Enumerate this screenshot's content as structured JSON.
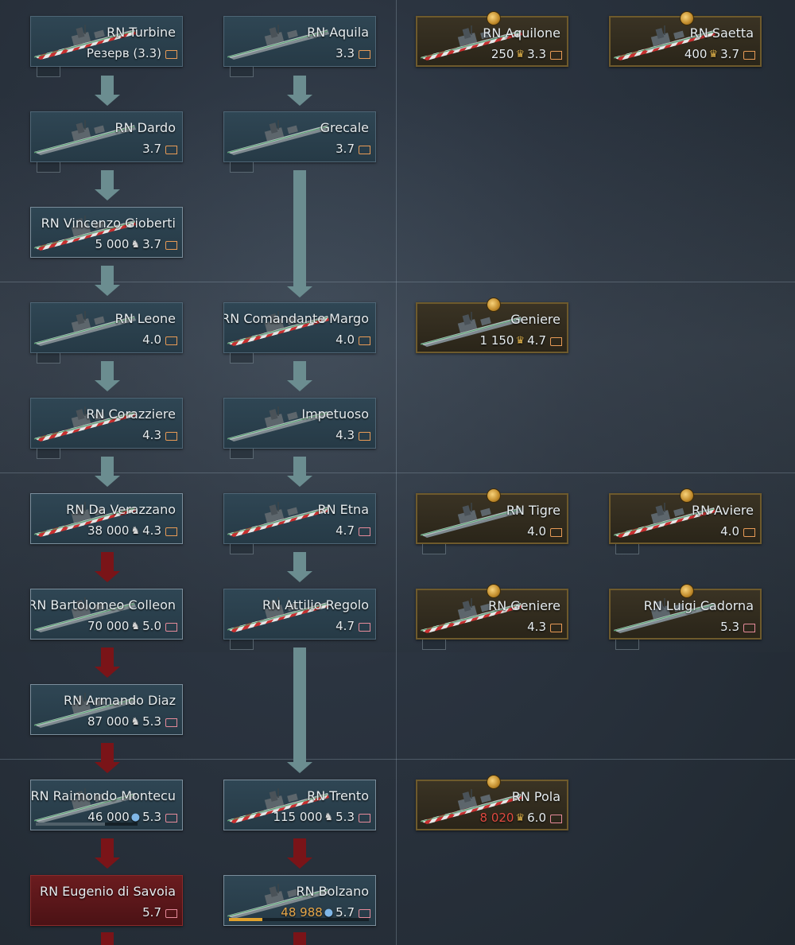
{
  "colors": {
    "premium_border": "#6e5a2c",
    "locked_bg": "#6b1c1f",
    "arrow_researched": "#6b8d90",
    "arrow_locked": "#7a1418",
    "progress": "#e0a22e"
  },
  "cards": {
    "turbine": {
      "name": "RN Turbine",
      "status": "Резерв (3.3)"
    },
    "aquila": {
      "name": "RN Aquila",
      "br": "3.3"
    },
    "aquilone": {
      "name": "RN Aquilone",
      "cost": "250",
      "br": "3.3"
    },
    "saetta": {
      "name": "RN Saetta",
      "cost": "400",
      "br": "3.7"
    },
    "dardo": {
      "name": "RN Dardo",
      "br": "3.7"
    },
    "grecale": {
      "name": "Grecale",
      "br": "3.7"
    },
    "gioberti": {
      "name": "RN Vincenzo Gioberti",
      "cost": "5 000",
      "br": "3.7"
    },
    "leone": {
      "name": "RN Leone",
      "br": "4.0"
    },
    "margo": {
      "name": "RN Comandante Margo",
      "br": "4.0"
    },
    "geniere_p": {
      "name": "Geniere",
      "cost": "1 150",
      "br": "4.7"
    },
    "corazziere": {
      "name": "RN Corazziere",
      "br": "4.3"
    },
    "impetuoso": {
      "name": "Impetuoso",
      "br": "4.3"
    },
    "verazzano": {
      "name": "RN Da Verazzano",
      "cost": "38 000",
      "br": "4.3"
    },
    "etna": {
      "name": "RN Etna",
      "br": "4.7"
    },
    "tigre": {
      "name": "RN Tigre",
      "br": "4.0"
    },
    "aviere": {
      "name": "RN Aviere",
      "br": "4.0"
    },
    "colleoni": {
      "name": "RN Bartolomeo Colleon",
      "cost": "70 000",
      "br": "5.0"
    },
    "regolo": {
      "name": "RN Attilio Regolo",
      "br": "4.7"
    },
    "geniere": {
      "name": "RN Geniere",
      "br": "4.3"
    },
    "cadorna": {
      "name": "RN Luigi Cadorna",
      "br": "5.3"
    },
    "diaz": {
      "name": "RN Armando Diaz",
      "cost": "87 000",
      "br": "5.3"
    },
    "montecu": {
      "name": "RN Raimondo Montecu",
      "cost": "46 000",
      "br": "5.3",
      "progress": 0.68
    },
    "trento": {
      "name": "RN Trento",
      "cost": "115 000",
      "br": "5.3"
    },
    "pola": {
      "name": "RN Pola",
      "cost": "8 020",
      "br": "6.0"
    },
    "savoia": {
      "name": "RN Eugenio di Savoia",
      "br": "5.7"
    },
    "bolzano": {
      "name": "RN Bolzano",
      "cost": "48 988",
      "br": "5.7",
      "progress": 0.24
    }
  }
}
